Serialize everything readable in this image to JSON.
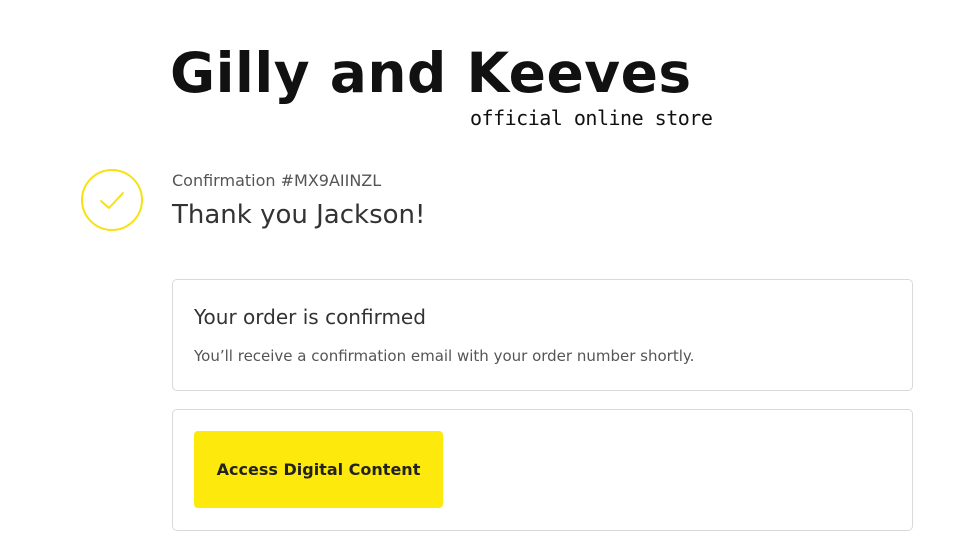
{
  "brand": {
    "name": "Gilly and Keeves",
    "tagline": "official online store"
  },
  "header": {
    "confirmation_label": "Confirmation #MX9AIINZL",
    "thank_you": "Thank you Jackson!"
  },
  "order_card": {
    "title": "Your order is confirmed",
    "message": "You’ll receive a confirmation email with your order number shortly."
  },
  "digital_card": {
    "button_label": "Access Digital Content"
  },
  "icons": {
    "status": "checkmark-icon"
  },
  "colors": {
    "accent": "#fde90b",
    "check_circle": "#f5e210",
    "card_border": "#d9d9d9",
    "text": "#333333"
  }
}
